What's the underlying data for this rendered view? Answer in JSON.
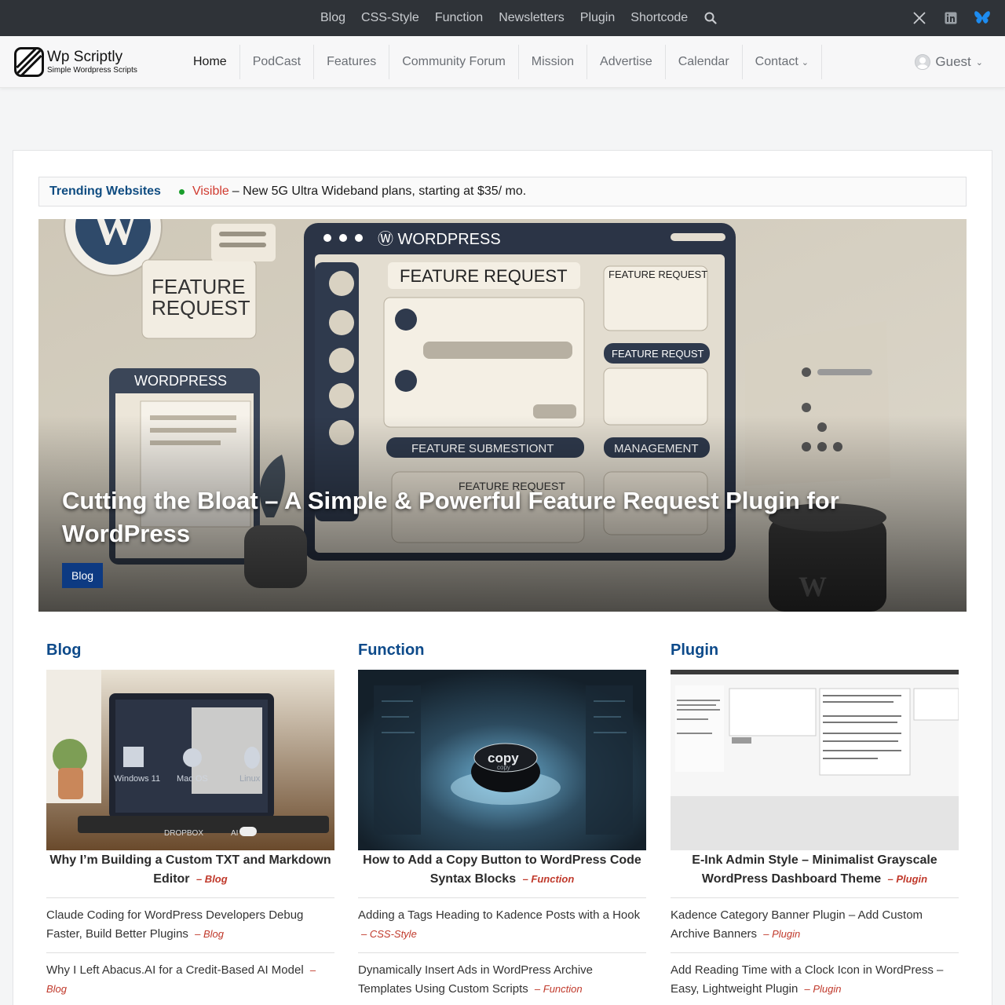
{
  "topbar": {
    "links": [
      "Blog",
      "CSS-Style",
      "Function",
      "Newsletters",
      "Plugin",
      "Shortcode"
    ],
    "search_icon": "search-icon",
    "social_icons": [
      "x-twitter-icon",
      "linkedin-icon",
      "bluesky-icon"
    ]
  },
  "header": {
    "logo_name": "Wp Scriptly",
    "logo_tagline": "Simple Wordpress Scripts",
    "nav": [
      "Home",
      "PodCast",
      "Features",
      "Community Forum",
      "Mission",
      "Advertise",
      "Calendar",
      "Contact"
    ],
    "active": "Home",
    "user": "Guest"
  },
  "trending": {
    "label": "Trending Websites",
    "link": "Visible",
    "text": "– New 5G Ultra Wideband plans, starting at $35/ mo."
  },
  "hero": {
    "title": "Cutting the Bloat – A Simple & Powerful Feature Request Plugin for WordPress",
    "category": "Blog",
    "image_text": [
      "FEATURE REQUEST",
      "WORDPRESS",
      "FEATURE REQUEST",
      "FEATURE REQUEST",
      "FEATURE REQUST",
      "FEATURE SUBMESTIONT",
      "MANAGEMENT",
      "FEATURE REQUEST",
      "WORDPRESS"
    ]
  },
  "columns": [
    {
      "heading": "Blog",
      "featured_title": "Why I’m Building a Custom TXT and Markdown Editor",
      "featured_cat": "– Blog",
      "thumb_text": [
        "Windows 11",
        "Mac OS",
        "Linux",
        "DROPBOX",
        "AI"
      ],
      "posts": [
        {
          "title": "Claude Coding for WordPress Developers Debug Faster, Build Better Plugins",
          "cat": "– Blog"
        },
        {
          "title": "Why I Left Abacus.AI for a Credit-Based AI Model",
          "cat": "– Blog"
        }
      ]
    },
    {
      "heading": "Function",
      "featured_title": "How to Add a Copy Button to WordPress Code Syntax Blocks",
      "featured_cat": "– Function",
      "thumb_text": [
        "copy",
        "copy"
      ],
      "posts": [
        {
          "title": "Adding a Tags Heading to Kadence Posts with a Hook",
          "cat": "– CSS-Style"
        },
        {
          "title": "Dynamically Insert Ads in WordPress Archive Templates Using Custom Scripts",
          "cat": "– Function"
        }
      ]
    },
    {
      "heading": "Plugin",
      "featured_title": "E-Ink Admin Style – Minimalist Grayscale WordPress Dashboard Theme",
      "featured_cat": "– Plugin",
      "thumb_text": [],
      "posts": [
        {
          "title": "Kadence Category Banner Plugin – Add Custom Archive Banners",
          "cat": "– Plugin"
        },
        {
          "title": "Add Reading Time with a Clock Icon in WordPress – Easy, Lightweight Plugin",
          "cat": "– Plugin"
        }
      ]
    }
  ],
  "colors": {
    "accent": "#0d4a8a",
    "topbar": "#2f3338",
    "badge": "#0d3a82",
    "category": "#c0392b",
    "trending_dot": "#1a9e2c"
  }
}
